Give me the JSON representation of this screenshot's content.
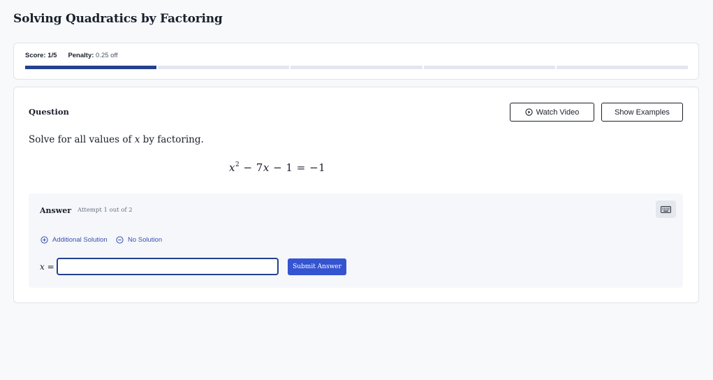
{
  "page": {
    "title": "Solving Quadratics by Factoring"
  },
  "score": {
    "score_label": "Score:",
    "score_value": "1/5",
    "penalty_label": "Penalty:",
    "penalty_value": "0.25 off",
    "progress_completed": 1,
    "progress_total": 5,
    "progress_done_color": "#24418f",
    "progress_todo_color": "#e2e7ef"
  },
  "question": {
    "label": "Question",
    "watch_video_label": "Watch Video",
    "watch_video_icon": "play-circle-icon",
    "show_examples_label": "Show Examples",
    "prompt_before": "Solve for all values of ",
    "prompt_variable": "x",
    "prompt_after": " by factoring.",
    "equation": {
      "var1": "x",
      "exp": "2",
      "mid": " − 7",
      "var2": "x",
      "rhs": " − 1 = −1"
    }
  },
  "answer": {
    "label": "Answer",
    "attempt_text": "Attempt 1 out of 2",
    "keyboard_icon": "keyboard-icon",
    "additional_solution_label": "Additional Solution",
    "additional_solution_icon": "plus-circle-icon",
    "no_solution_label": "No Solution",
    "no_solution_icon": "minus-circle-icon",
    "var": "x",
    "equals": " =",
    "input_value": "",
    "submit_label": "Submit Answer",
    "accent_color": "#3554d1"
  }
}
